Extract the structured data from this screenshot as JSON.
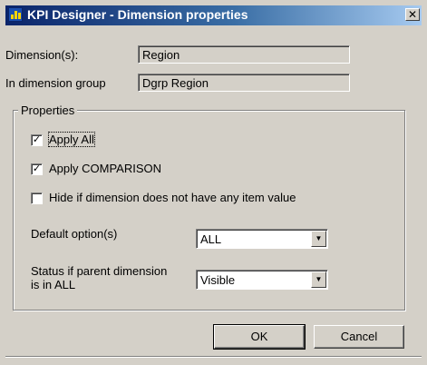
{
  "window": {
    "title": "KPI Designer - Dimension properties",
    "close_glyph": "✕",
    "icon": "kpi-app-icon"
  },
  "fields": {
    "dimensions_label": "Dimension(s):",
    "dimensions_value": "Region",
    "in_group_label": "In dimension group",
    "in_group_value": "Dgrp Region"
  },
  "properties": {
    "legend": "Properties",
    "checkboxes": [
      {
        "label": "Apply All",
        "checked": true
      },
      {
        "label": "Apply COMPARISON",
        "checked": true
      },
      {
        "label": "Hide if dimension does not have any item value",
        "checked": false
      }
    ],
    "default_options_label": "Default option(s)",
    "default_options_value": "ALL",
    "status_label_line1": "Status if parent dimension",
    "status_label_line2": "is in ALL",
    "status_value": "Visible",
    "dropdown_glyph": "▼"
  },
  "buttons": {
    "ok": "OK",
    "cancel": "Cancel"
  }
}
